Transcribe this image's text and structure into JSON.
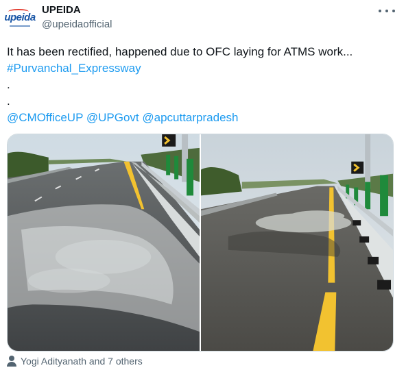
{
  "account": {
    "name": "UPEIDA",
    "handle": "@upeidaofficial",
    "avatar_logo_text": "upeida",
    "avatar_icon": "upeida-logo-icon"
  },
  "more_icon": "more-horizontal-icon",
  "tweet": {
    "line1": "It has been rectified, happened due to OFC laying for ATMS work...",
    "hashtag": "#Purvanchal_Expressway",
    "dot1": ".",
    "dot2": ".",
    "mentions": [
      "@CMOfficeUP",
      "@UPGovt",
      "@apcuttarpradesh"
    ]
  },
  "media": {
    "photos": [
      {
        "icon": "expressway-photo-before"
      },
      {
        "icon": "expressway-photo-after"
      }
    ]
  },
  "likes": {
    "icon": "person-icon",
    "text": "Yogi Adityanath and 7 others"
  },
  "colors": {
    "link": "#1d9bf0",
    "secondary_text": "#536471",
    "road_marking_yellow": "#f2c230"
  }
}
